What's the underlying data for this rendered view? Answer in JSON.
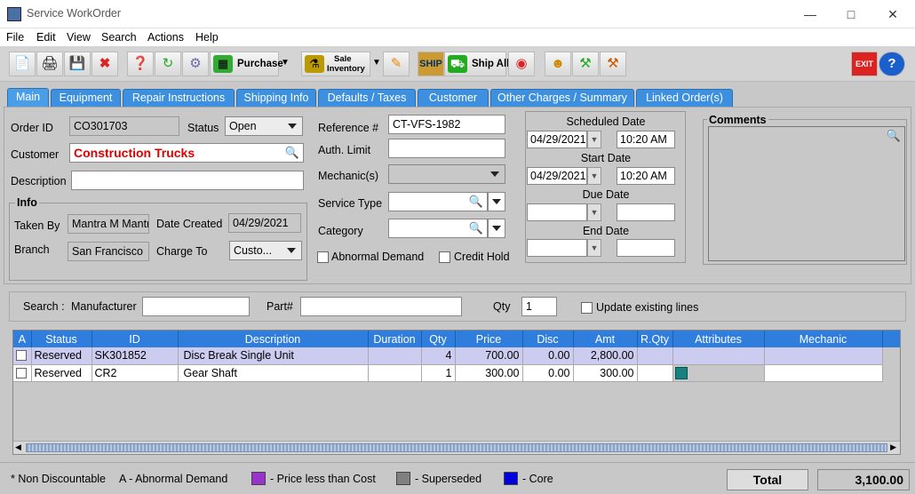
{
  "window": {
    "title": "Service WorkOrder"
  },
  "menu": [
    "File",
    "Edit",
    "View",
    "Search",
    "Actions",
    "Help"
  ],
  "toolbar": {
    "purchase_label": "Purchase",
    "sale_inventory_label_1": "Sale",
    "sale_inventory_label_2": "Inventory",
    "ship_all_label": "Ship All"
  },
  "tabs": [
    "Main",
    "Equipment",
    "Repair Instructions",
    "Shipping Info",
    "Defaults / Taxes",
    "Customer",
    "Other Charges / Summary",
    "Linked Order(s)"
  ],
  "main": {
    "order_id_label": "Order ID",
    "order_id": "CO301703",
    "status_label": "Status",
    "status": "Open",
    "customer_label": "Customer",
    "customer": "Construction Trucks",
    "description_label": "Description",
    "description": "",
    "info_title": "Info",
    "taken_by_label": "Taken By",
    "taken_by": "Mantra M Mantra",
    "date_created_label": "Date Created",
    "date_created": "04/29/2021",
    "branch_label": "Branch",
    "branch": "San Francisco",
    "charge_to_label": "Charge To",
    "charge_to": "Custo...",
    "reference_label": "Reference #",
    "reference": "CT-VFS-1982",
    "auth_limit_label": "Auth. Limit",
    "mechanics_label": "Mechanic(s)",
    "service_type_label": "Service Type",
    "category_label": "Category",
    "abnormal_demand_label": "Abnormal Demand",
    "credit_hold_label": "Credit Hold",
    "scheduled_date_label": "Scheduled Date",
    "scheduled_date": "04/29/2021",
    "scheduled_time": "10:20 AM",
    "start_date_label": "Start Date",
    "start_date": "04/29/2021",
    "start_time": "10:20 AM",
    "due_date_label": "Due Date",
    "end_date_label": "End Date",
    "comments_label": "Comments"
  },
  "search": {
    "search_label": "Search :",
    "manufacturer_label": "Manufacturer",
    "part_label": "Part#",
    "qty_label": "Qty",
    "qty": "1",
    "update_label": "Update existing lines"
  },
  "grid": {
    "columns": [
      "A",
      "Status",
      "ID",
      "Description",
      "Duration",
      "Qty",
      "Price",
      "Disc",
      "Amt",
      "R.Qty",
      "Attributes",
      "Mechanic"
    ],
    "rows": [
      {
        "status": "Reserved",
        "id": "SK301852",
        "description": "Disc Break Single Unit",
        "duration": "",
        "qty": "4",
        "price": "700.00",
        "disc": "0.00",
        "amt": "2,800.00",
        "rqty": "",
        "attributes": "",
        "mechanic": ""
      },
      {
        "status": "Reserved",
        "id": "CR2",
        "description": "Gear Shaft",
        "duration": "",
        "qty": "1",
        "price": "300.00",
        "disc": "0.00",
        "amt": "300.00",
        "rqty": "",
        "attributes": "",
        "mechanic": ""
      }
    ]
  },
  "footer": {
    "non_discountable": "* Non Discountable",
    "abnormal_demand": "A - Abnormal Demand",
    "price_less": "- Price less than Cost",
    "superseded": "- Superseded",
    "core": "- Core",
    "total_label": "Total",
    "total_value": "3,100.00"
  },
  "colors": {
    "tab_blue": "#3d8fe0",
    "header_blue": "#2f7ddd",
    "selected_row": "#ccccf0",
    "customer_red": "#e00000",
    "price_less_swatch": "#9933cc",
    "superseded_swatch": "#808080",
    "core_swatch": "#0000dd",
    "attribute_swatch": "#1a8080"
  }
}
